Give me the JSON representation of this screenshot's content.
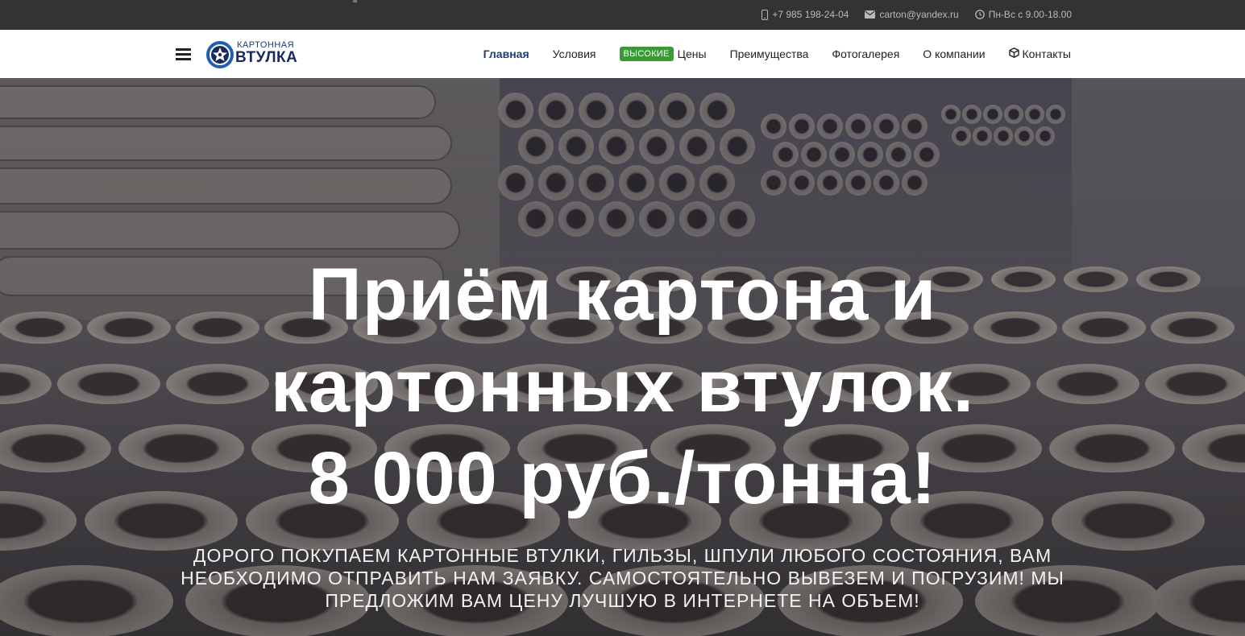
{
  "topbar": {
    "phone": "+7 985 198-24-04",
    "email": "carton@yandex.ru",
    "hours": "Пн-Вс с 9.00-18.00",
    "icons": [
      "mobile-phone-icon",
      "envelope-icon",
      "clock-icon"
    ]
  },
  "header": {
    "logo": {
      "small_text": "КАРТОННАЯ",
      "big_text": "ВТУЛКА"
    },
    "nav": {
      "home": "Главная",
      "conditions": "Условия",
      "prices_badge": "ВЫСОКИЕ",
      "prices": "Цены",
      "advantages": "Преимущества",
      "gallery": "Фотогалерея",
      "about": "О компании",
      "contacts": "Контакты"
    }
  },
  "hero": {
    "headline_line1": "Приём картона и",
    "headline_line2": "картонных втулок.",
    "headline_line3": "8 000 руб./тонна!",
    "subtext": "ДОРОГО ПОКУПАЕМ КАРТОННЫЕ ВТУЛКИ, ГИЛЬЗЫ, ШПУЛИ ЛЮБОГО СОСТОЯНИЯ, ВАМ НЕОБХОДИМО ОТПРАВИТЬ НАМ ЗАЯВКУ. САМОСТОЯТЕЛЬНО ВЫВЕЗЕМ И ПОГРУЗИМ! МЫ ПРЕДЛОЖИМ ВАМ ЦЕНУ ЛУЧШУЮ В ИНТЕРНЕТЕ НА ОБЪЕМ!"
  },
  "colors": {
    "topbar_bg": "#333333",
    "nav_active": "#1a3e73",
    "badge_green": "#3a9b35",
    "logo_blue": "#1b2a5e"
  }
}
